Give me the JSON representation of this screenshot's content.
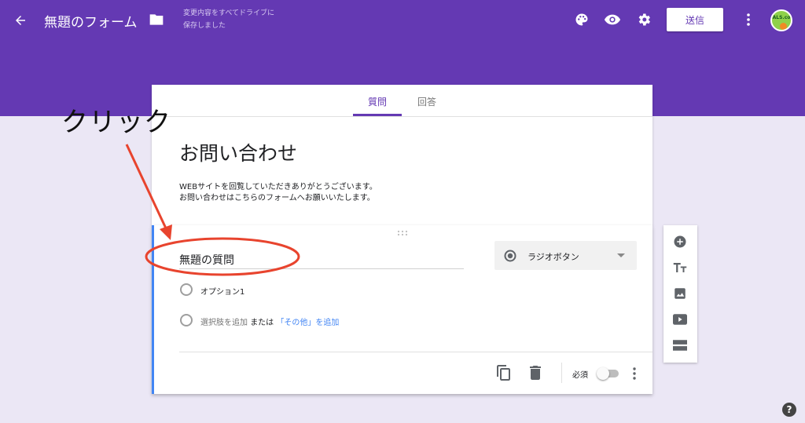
{
  "header": {
    "form_title": "無題のフォーム",
    "saved_status_line1": "変更内容をすべてドライブに",
    "saved_status_line2": "保存しました",
    "send_label": "送信",
    "icons": [
      "back-arrow-icon",
      "folder-icon",
      "palette-icon",
      "eye-icon",
      "gear-icon",
      "more-vert-icon"
    ],
    "avatar_text": "ALS.co"
  },
  "tabs": [
    {
      "label": "質問",
      "active": true
    },
    {
      "label": "回答",
      "active": false
    }
  ],
  "form": {
    "title": "お問い合わせ",
    "description_line1": "WEBサイトを回覧していただきありがとうございます。",
    "description_line2": "お問い合わせはこちらのフォームへお願いいたします。"
  },
  "question": {
    "title": "無題の質問",
    "type_label": "ラジオボタン",
    "option1": "オプション1",
    "add_option": "選択肢を追加",
    "or_text": "または",
    "add_other": "「その他」を追加",
    "required_label": "必須",
    "required": false
  },
  "side_tools": [
    "add-question-icon",
    "add-title-icon",
    "add-image-icon",
    "add-video-icon",
    "add-section-icon"
  ],
  "annotation": {
    "text": "クリック"
  },
  "colors": {
    "accent": "#6439b3",
    "focus_bar": "#4285f4",
    "annotation": "#e8442e"
  }
}
